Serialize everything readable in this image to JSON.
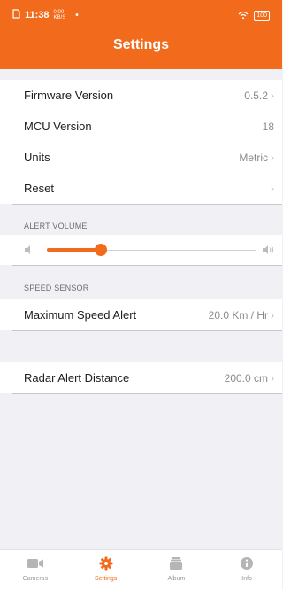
{
  "status_bar": {
    "time": "11:38",
    "net_speed_top": "0.00",
    "net_speed_bottom": "KB/S",
    "dot": "•",
    "battery": "100"
  },
  "header": {
    "title": "Settings"
  },
  "device_info": [
    {
      "label": "Firmware Version",
      "value": "0.5.2",
      "has_chevron": true
    },
    {
      "label": "MCU Version",
      "value": "18",
      "has_chevron": false
    },
    {
      "label": "Units",
      "value": "Metric",
      "has_chevron": true
    },
    {
      "label": "Reset",
      "value": "",
      "has_chevron": true
    }
  ],
  "alert_volume": {
    "section_label": "ALERT VOLUME",
    "level": 0.26
  },
  "speed_sensor": {
    "section_label": "SPEED SENSOR",
    "max_speed_label": "Maximum Speed Alert",
    "max_speed_value": "20.0 Km / Hr"
  },
  "radar": {
    "label": "Radar Alert Distance",
    "value": "200.0 cm"
  },
  "tabs": [
    {
      "label": "Cameras",
      "icon": "camera-icon",
      "active": false
    },
    {
      "label": "Settings",
      "icon": "gear-icon",
      "active": true
    },
    {
      "label": "Album",
      "icon": "album-icon",
      "active": false
    },
    {
      "label": "Info",
      "icon": "info-icon",
      "active": false
    }
  ],
  "colors": {
    "accent": "#f26a1b",
    "background": "#f1f1f5",
    "inactive_tab": "#9a9a9a"
  }
}
